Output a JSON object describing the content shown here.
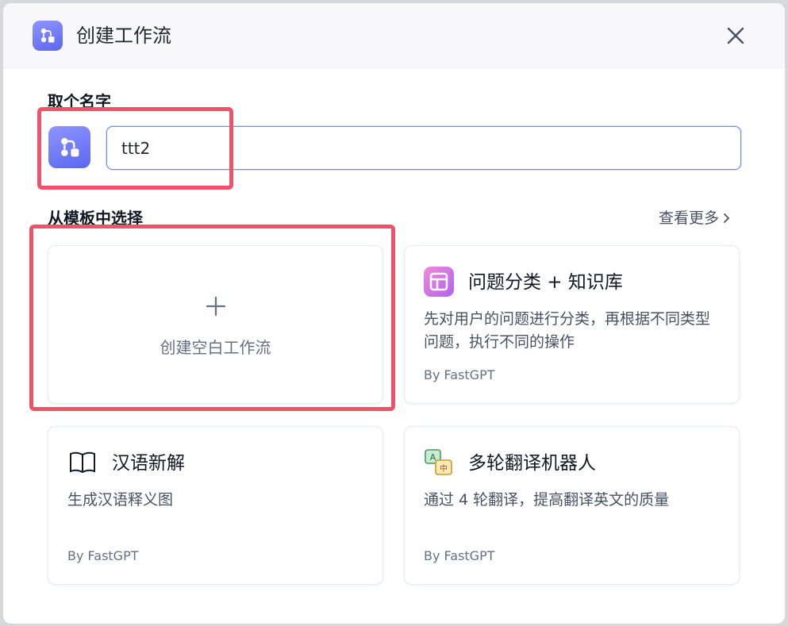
{
  "header": {
    "title": "创建工作流",
    "icon": "workflow-icon",
    "close_icon": "close-icon"
  },
  "name_section": {
    "label": "取个名字",
    "input_value": "ttt2",
    "avatar_icon": "workflow-icon"
  },
  "template_section": {
    "label": "从模板中选择",
    "see_more": "查看更多"
  },
  "blank_card": {
    "icon": "plus-icon",
    "label": "创建空白工作流"
  },
  "templates": [
    {
      "icon": "layout-icon",
      "title": "问题分类 + 知识库",
      "description": "先对用户的问题进行分类，再根据不同类型问题，执行不同的操作",
      "author": "By FastGPT"
    },
    {
      "icon": "book-icon",
      "title": "汉语新解",
      "description": "生成汉语释义图",
      "author": "By FastGPT"
    },
    {
      "icon": "translate-icon",
      "title": "多轮翻译机器人",
      "description": "通过 4 轮翻译，提高翻译英文的质量",
      "author": "By FastGPT"
    }
  ],
  "colors": {
    "accent": "#5a67f0",
    "highlight": "#f5506a",
    "input_border": "#6f8cf2"
  }
}
